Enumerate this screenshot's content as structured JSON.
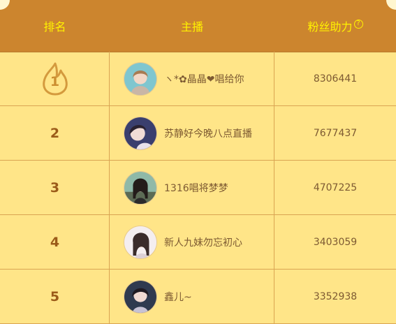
{
  "header": {
    "rank": "排名",
    "host": "主播",
    "fans": "粉丝助力",
    "help_icon": "question-circle-icon"
  },
  "rows": [
    {
      "rank": "1",
      "name": "ヽ*✿晶晶❤唱给你",
      "fans": "8306441",
      "badge": "flame-icon"
    },
    {
      "rank": "2",
      "name": "苏静好今晚八点直播",
      "fans": "7677437"
    },
    {
      "rank": "3",
      "name": "1316唱将梦梦",
      "fans": "4707225"
    },
    {
      "rank": "4",
      "name": "新人九妹勿忘初心",
      "fans": "3403059"
    },
    {
      "rank": "5",
      "name": "鑫儿~",
      "fans": "3352938"
    }
  ],
  "colors": {
    "header_bg": "#cc852e",
    "header_text": "#fff200",
    "row_bg": "#ffe588",
    "rank_text": "#9b5b19",
    "divider": "#d9a452"
  }
}
